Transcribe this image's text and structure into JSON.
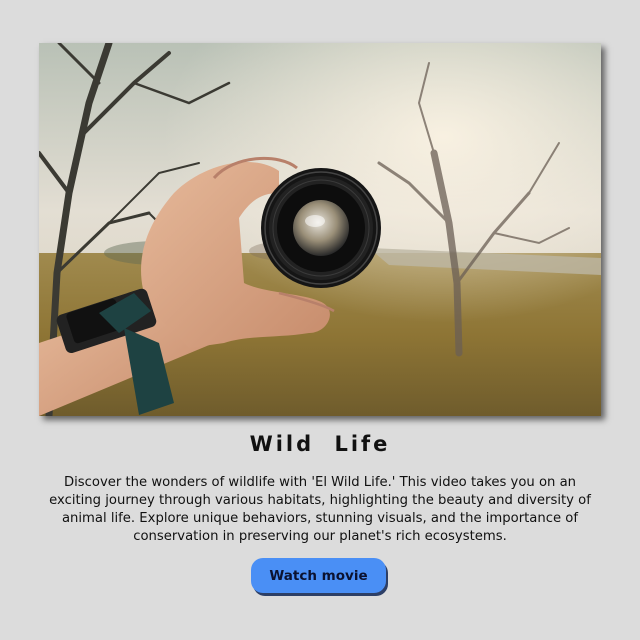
{
  "card": {
    "title": "Wild  Life",
    "description": "Discover the wonders of wildlife with 'El Wild Life.' This video takes you on an exciting journey through various habitats, highlighting the beauty and diversity of animal life. Explore unique behaviors, stunning visuals, and the importance of conservation in preserving our planet's rich ecosystems.",
    "button_label": "Watch movie"
  },
  "hero_image": {
    "subject": "hand-holding-camera-lens-in-autumn-field"
  },
  "colors": {
    "page_background": "#dcdcdc",
    "button_background": "#4a8ff5",
    "button_shadow": "#2d3f66",
    "text": "#111111"
  }
}
